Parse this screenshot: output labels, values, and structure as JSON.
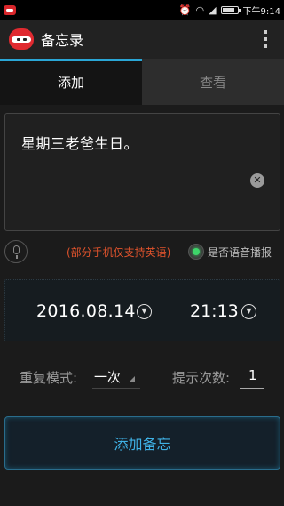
{
  "status_bar": {
    "time": "下午9:14",
    "battery_level": 0.85,
    "icons": [
      "app-notification-icon",
      "alarm-icon",
      "wifi-icon",
      "signal-icon",
      "battery-icon"
    ]
  },
  "action_bar": {
    "title": "备忘录",
    "logo_icon": "ninja-logo-icon",
    "menu_icon": "overflow-menu-icon"
  },
  "tabs": [
    {
      "label": "添加",
      "selected": true
    },
    {
      "label": "查看",
      "selected": false
    }
  ],
  "memo": {
    "text": "星期三老爸生日。"
  },
  "voice": {
    "note": "(部分手机仅支持英语)",
    "toggle_label": "是否语音播报",
    "toggle_on": true
  },
  "schedule": {
    "date": "2016.08.14",
    "time": "21:13"
  },
  "repeat": {
    "label": "重复模式:",
    "value": "一次"
  },
  "reminder_count": {
    "label": "提示次数:",
    "value": "1"
  },
  "submit": {
    "label": "添加备忘"
  },
  "colors": {
    "accent": "#2aa6d6",
    "warning_text": "#e0532c",
    "toggle_on": "#3ed66a",
    "button_text": "#3fb2e6"
  }
}
